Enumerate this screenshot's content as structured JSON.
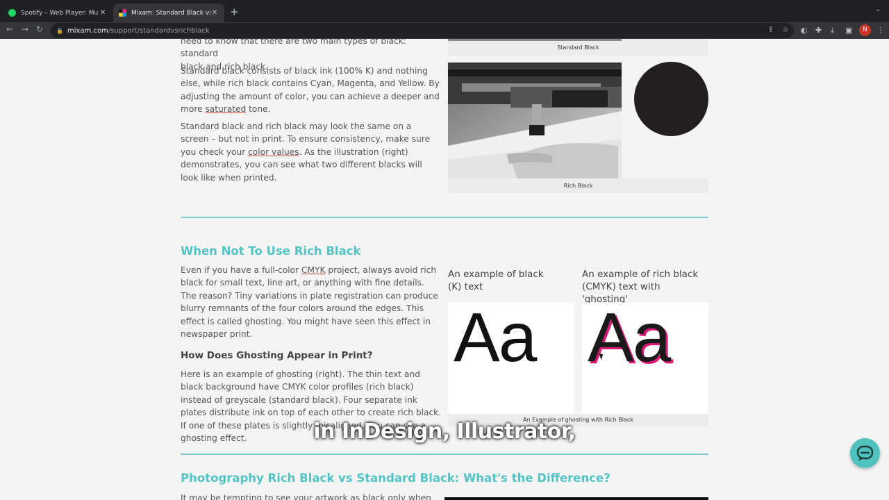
{
  "browser": {
    "tabs": [
      {
        "title": "Spotify – Web Player: Music fo",
        "favicon": "spotify-icon"
      },
      {
        "title": "Mixam: Standard Black vs Rich",
        "favicon": "mixam-icon"
      }
    ],
    "new_tab": "+",
    "close_glyph": "✕",
    "url_host": "mixam.com",
    "url_path": "/support/standardvsrichblack",
    "profile_initial": "N"
  },
  "intro": {
    "line_top": "need to know that there are two main types of black: standard",
    "line_top2": "black and rich black.",
    "p1_a": "Standard black consists of black ink (100% K) and nothing else, while rich black contains Cyan, Magenta, and Yellow. By adjusting the amount of color, you can achieve a deeper and more ",
    "p1_link": "saturated",
    "p1_b": " tone.",
    "p2_a": "Standard black and rich black may look the same on a screen – but not in print. To ensure consistency, make sure you check your ",
    "p2_link": "color values",
    "p2_b": ". As the illustration (right) demonstrates, you can see what two different blacks will look like when printed."
  },
  "figures": {
    "standard_caption": "Standard Black",
    "rich_caption": "Rich Black"
  },
  "section_rich": {
    "heading": "When Not To Use Rich Black",
    "p_a": "Even if you have a full-color ",
    "p_link": "CMYK",
    "p_b": " project, always avoid rich black for small text, line art, or anything with fine details. The reason? Tiny variations in plate registration can produce blurry remnants of the four colors around the edges. This effect is called ghosting. You might have seen this effect in newspaper print.",
    "subheading": "How Does Ghosting Appear in Print?",
    "p2": "Here is an example of ghosting (right). The thin text and black background have CMYK color profiles (rich black) instead of greyscale (standard black). Four separate ink plates distribute ink on top of each other to create rich black. If one of these plates is slightly misaligned, you can see a ghosting effect."
  },
  "ghost_example": {
    "label_left": "An example of black (K) text",
    "label_right": "An example of rich black (CMYK) text with 'ghosting'",
    "sample_text": "Aa",
    "caption": "An Example of ghosting with Rich Black"
  },
  "section_photo": {
    "heading": "Photography Rich Black vs Standard Black: What's the Difference?",
    "p_start": "It may be tempting to see your artwork as black only when your"
  },
  "subtitle": "in InDesign, Illustrator,",
  "colors": {
    "accent": "#53c3c3",
    "rule": "#7fcfcf",
    "ghost_magenta": "#d81a76"
  }
}
